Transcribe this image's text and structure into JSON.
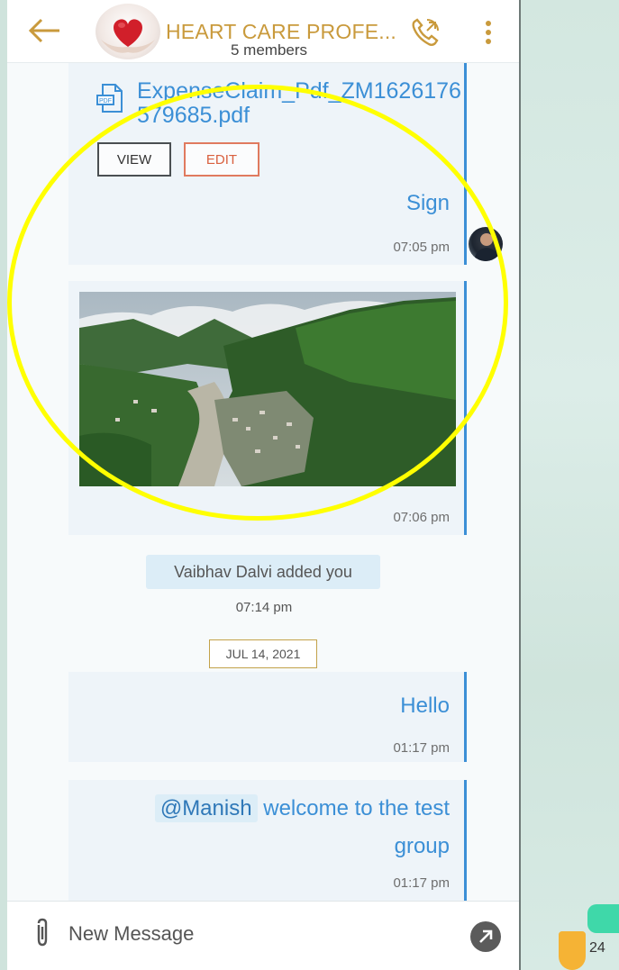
{
  "header": {
    "title": "HEART CARE PROFE...",
    "subtitle": "5 members",
    "back_icon": "arrow-left-icon",
    "call_icon": "phone-call-icon",
    "menu_icon": "kebab-menu-icon",
    "title_color": "#c99a3c"
  },
  "messages": [
    {
      "type": "file",
      "file_name": "ExpenseClaim_Pdf_ZM1626176579685.pdf",
      "view_label": "VIEW",
      "edit_label": "EDIT",
      "text": "Sign",
      "time": "07:05 pm"
    },
    {
      "type": "image",
      "image_desc_icon": "landscape-photo",
      "time": "07:06 pm"
    },
    {
      "type": "system",
      "text": "Vaibhav  Dalvi added you",
      "time": "07:14 pm"
    },
    {
      "type": "date",
      "text": "JUL 14, 2021"
    },
    {
      "type": "text",
      "text": "Hello",
      "time": "01:17 pm"
    },
    {
      "type": "text",
      "mention": "@Manish",
      "text_line1": " welcome to the test",
      "text_line2": "group",
      "time": "01:17 pm"
    }
  ],
  "composer": {
    "placeholder": "New Message",
    "attach_icon": "paperclip-icon",
    "send_icon": "send-arrow-icon"
  },
  "page_badge": {
    "number": "24"
  },
  "colors": {
    "accent": "#3b8fd6",
    "highlight": "#ffff00",
    "edit": "#d9603f"
  }
}
